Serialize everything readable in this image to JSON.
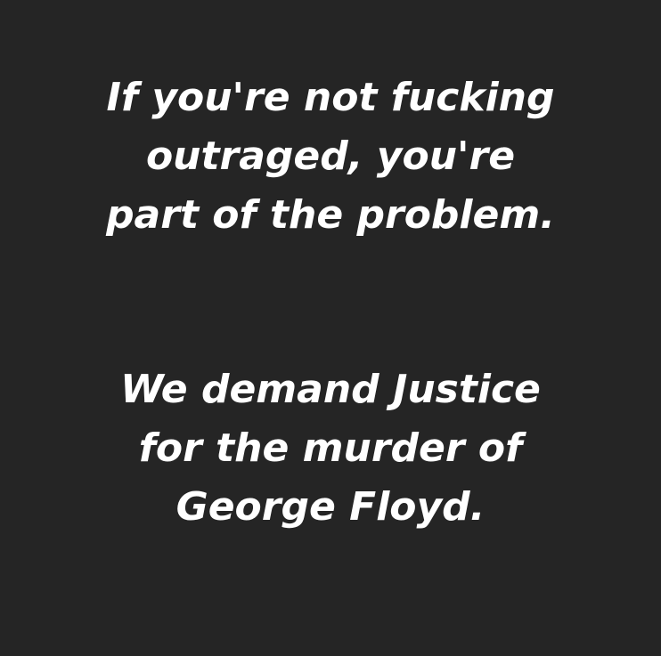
{
  "background_color": "#252525",
  "text_color": "#ffffff",
  "statement": {
    "lines": [
      "If you're not fucking",
      "outraged, you're",
      "part of the problem."
    ]
  },
  "demand": {
    "lines": [
      "We demand Justice",
      "for the murder of",
      "George Floyd."
    ]
  }
}
